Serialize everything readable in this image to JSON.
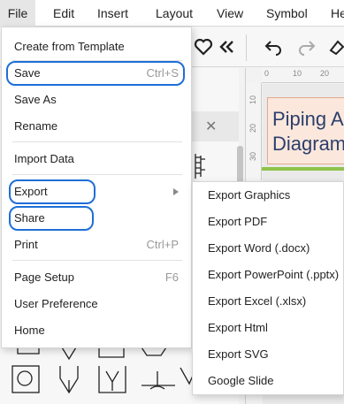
{
  "menubar": {
    "items": [
      {
        "label": "File",
        "active": true
      },
      {
        "label": "Edit"
      },
      {
        "label": "Insert"
      },
      {
        "label": "Layout"
      },
      {
        "label": "View"
      },
      {
        "label": "Symbol"
      },
      {
        "label": "He"
      }
    ]
  },
  "file_menu": {
    "items": [
      {
        "label": "Create from Template",
        "shortcut": ""
      },
      {
        "label": "Save",
        "shortcut": "Ctrl+S",
        "highlighted": true
      },
      {
        "label": "Save As",
        "shortcut": ""
      },
      {
        "label": "Rename",
        "shortcut": ""
      },
      {
        "label": "Import Data",
        "shortcut": ""
      },
      {
        "label": "Export",
        "shortcut": "",
        "submenu": true,
        "highlighted": true
      },
      {
        "label": "Share",
        "shortcut": "",
        "highlighted": true
      },
      {
        "label": "Print",
        "shortcut": "Ctrl+P"
      },
      {
        "label": "Page Setup",
        "shortcut": "F6"
      },
      {
        "label": "User Preference",
        "shortcut": ""
      },
      {
        "label": "Home",
        "shortcut": ""
      }
    ]
  },
  "export_submenu": {
    "items": [
      {
        "label": "Export Graphics"
      },
      {
        "label": "Export PDF"
      },
      {
        "label": "Export Word (.docx)"
      },
      {
        "label": "Export PowerPoint (.pptx)"
      },
      {
        "label": "Export Excel (.xlsx)"
      },
      {
        "label": "Export Html"
      },
      {
        "label": "Export SVG"
      },
      {
        "label": "Google Slide"
      }
    ]
  },
  "canvas": {
    "title_line1": "Piping A",
    "title_line2": "Diagram",
    "ruler_top_ticks": [
      "0",
      "10",
      "20"
    ],
    "ruler_left_ticks": [
      "10",
      "20",
      "30"
    ]
  },
  "colors": {
    "highlight": "#1f6fd6",
    "card_fill": "#fbe7dc",
    "card_title": "#2c3f6b",
    "accent_green": "#8fc34a"
  },
  "icons": {
    "toolbar": [
      "heart-icon",
      "collapse-double-chevron-icon",
      "undo-icon",
      "redo-icon",
      "eraser-icon"
    ],
    "panel": [
      "close-icon"
    ]
  }
}
